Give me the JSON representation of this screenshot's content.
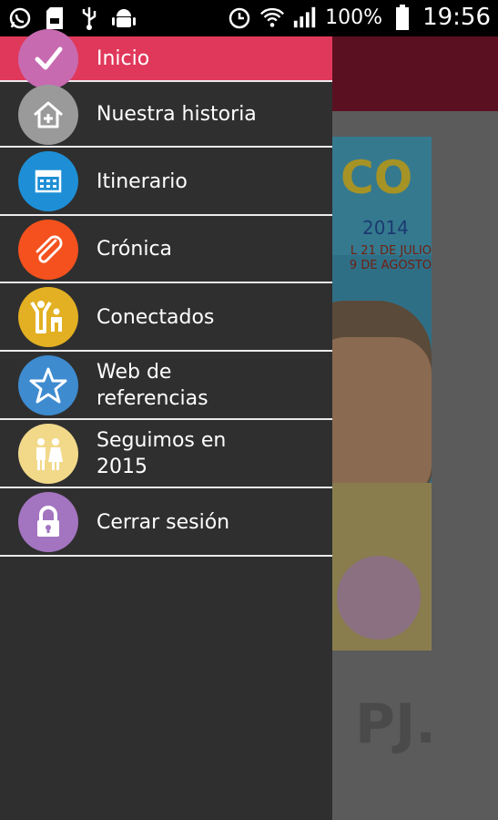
{
  "status_bar": {
    "battery_percent": "100%",
    "time": "19:56",
    "left_icons": [
      "whatsapp-icon",
      "sd-card-icon",
      "usb-icon",
      "android-icon"
    ],
    "right_icons": [
      "alarm-icon",
      "wifi-icon",
      "signal-icon",
      "battery-icon"
    ]
  },
  "poster": {
    "title": "CO",
    "year": "2014",
    "dates": "L 21 DE JULIO\n9 DE AGOSTO"
  },
  "background_logo": "PJ.",
  "drawer": {
    "items": [
      {
        "label": "Inicio",
        "icon": "check-icon",
        "icon_color": "#c76ab0",
        "active": true
      },
      {
        "label": "Nuestra historia",
        "icon": "home-add-icon",
        "icon_color": "#9a9a9a"
      },
      {
        "label": "Itinerario",
        "icon": "calendar-icon",
        "icon_color": "#1e8fd6"
      },
      {
        "label": "Crónica",
        "icon": "paperclip-icon",
        "icon_color": "#f4511e"
      },
      {
        "label": "Conectados",
        "icon": "people-icon",
        "icon_color": "#e2b022"
      },
      {
        "label": "Web de\nreferencias",
        "icon": "star-icon",
        "icon_color": "#3e8bd0"
      },
      {
        "label": "Seguimos en\n2015",
        "icon": "couple-icon",
        "icon_color": "#f2d98a"
      },
      {
        "label": "Cerrar sesión",
        "icon": "lock-icon",
        "icon_color": "#a375c0"
      }
    ]
  },
  "colors": {
    "active_item": "#e0385a",
    "drawer_bg": "#2f2f2f",
    "divider": "#eaeaea"
  }
}
